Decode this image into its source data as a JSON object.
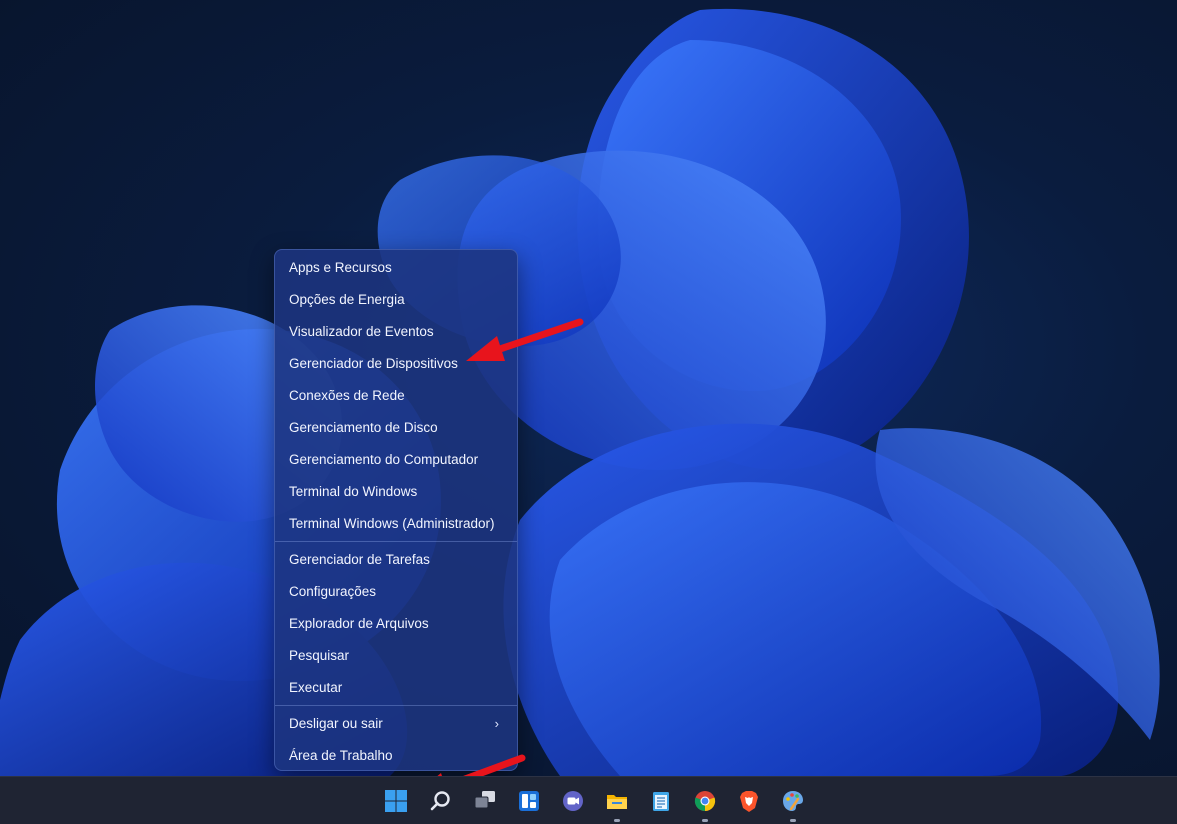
{
  "context_menu": {
    "items_group1": [
      "Apps e Recursos",
      "Opções de Energia",
      "Visualizador de Eventos",
      "Gerenciador de Dispositivos",
      "Conexões de Rede",
      "Gerenciamento de Disco",
      "Gerenciamento do Computador",
      "Terminal do Windows",
      "Terminal Windows (Administrador)"
    ],
    "items_group2": [
      "Gerenciador de Tarefas",
      "Configurações",
      "Explorador de Arquivos",
      "Pesquisar",
      "Executar"
    ],
    "items_group3": [
      "Desligar ou sair",
      "Área de Trabalho"
    ],
    "submenu_chevron": "›"
  },
  "taskbar": {
    "icons": [
      "start-windows-icon",
      "search-icon",
      "task-view-icon",
      "widgets-icon",
      "teams-chat-icon",
      "file-explorer-icon",
      "notepad-icon",
      "chrome-icon",
      "brave-icon",
      "paint-icon"
    ]
  },
  "colors": {
    "menu_bg": "#1c3480",
    "annotation_arrow": "#e8141c",
    "taskbar_bg": "#1f2433",
    "windows_blue": "#3aa0f0"
  }
}
